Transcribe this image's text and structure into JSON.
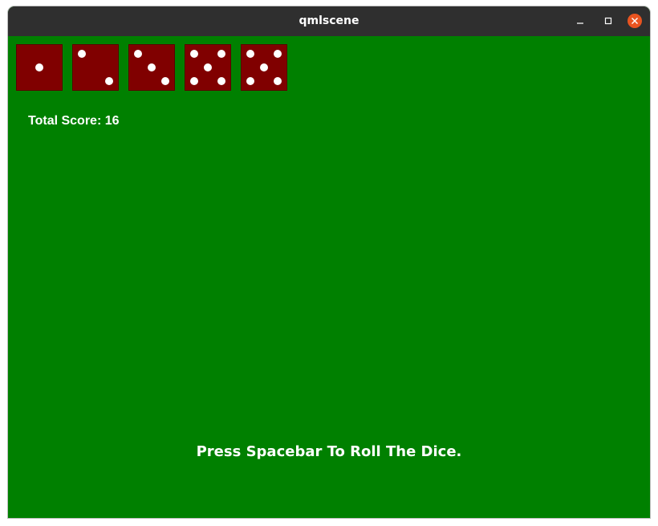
{
  "window": {
    "title": "qmlscene"
  },
  "game": {
    "background_color": "#008000",
    "die_color": "#800000",
    "pip_color": "#ffffff",
    "dice": [
      {
        "value": 1
      },
      {
        "value": 2
      },
      {
        "value": 3
      },
      {
        "value": 5
      },
      {
        "value": 5
      }
    ],
    "score_text": "Total Score: 16",
    "instruction": "Press Spacebar To Roll The Dice."
  },
  "icons": {
    "minimize": "minimize-icon",
    "maximize": "maximize-icon",
    "close": "close-icon"
  }
}
